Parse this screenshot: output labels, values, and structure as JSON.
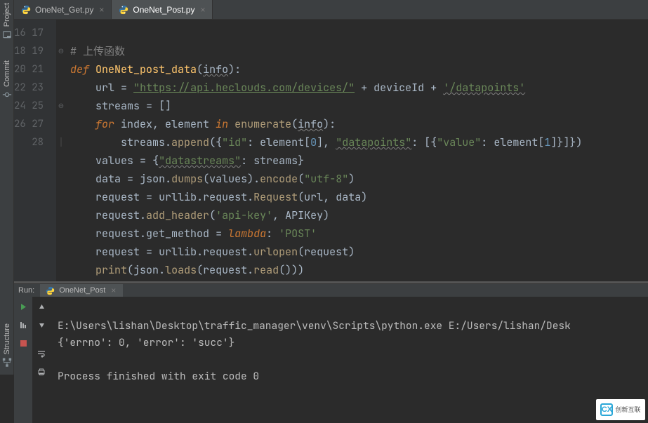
{
  "leftTools": [
    {
      "id": "project",
      "label": "Project"
    },
    {
      "id": "commit",
      "label": "Commit"
    },
    {
      "id": "structure",
      "label": "Structure"
    }
  ],
  "tabs": [
    {
      "id": "get",
      "label": "OneNet_Get.py",
      "active": false
    },
    {
      "id": "post",
      "label": "OneNet_Post.py",
      "active": true
    }
  ],
  "lineStart": 16,
  "lineEnd": 28,
  "code": {
    "l16": "# 上传函数",
    "l17_def": "def",
    "l17_name": "OneNet_post_data",
    "l17_arg": "info",
    "l18_url": "url",
    "l18_s1": "\"https://api.heclouds.com/devices/\"",
    "l18_dev": "deviceId",
    "l18_s2": "'/datapoints'",
    "l19": "streams = []",
    "l20_for": "for",
    "l20_idx": "index, element",
    "l20_in": "in",
    "l20_enum": "enumerate",
    "l20_arg": "info",
    "l21_streams": "streams",
    "l21_append": "append",
    "l21_id": "\"id\"",
    "l21_el": "element",
    "l21_z": "0",
    "l21_dp": "\"datapoints\"",
    "l21_val": "\"value\"",
    "l21_one": "1",
    "l22_values": "values",
    "l22_ds": "\"datastreams\"",
    "l22_streams": "streams",
    "l23_data": "data",
    "l23_json": "json",
    "l23_dumps": "dumps",
    "l23_vals": "values",
    "l23_enc": "encode",
    "l23_utf": "\"utf-8\"",
    "l24_req": "request",
    "l24_urllib": "urllib",
    "l24_r2": "request",
    "l24_Req": "Request",
    "l24_url": "url",
    "l24_data": "data",
    "l25_req": "request",
    "l25_add": "add_header",
    "l25_key": "'api-key'",
    "l25_api": "APIKey",
    "l26_req": "request",
    "l26_gm": "get_method",
    "l26_lambda": "lambda",
    "l26_post": "'POST'",
    "l27_req": "request",
    "l27_urllib": "urllib",
    "l27_r2": "request",
    "l27_open": "urlopen",
    "l27_arg": "request",
    "l28_print": "print",
    "l28_json": "json",
    "l28_loads": "loads",
    "l28_req": "request",
    "l28_read": "read"
  },
  "run": {
    "label": "Run:",
    "tabName": "OneNet_Post",
    "line1": "E:\\Users\\lishan\\Desktop\\traffic_manager\\venv\\Scripts\\python.exe E:/Users/lishan/Desk",
    "line2": "{'errno': 0, 'error': 'succ'}",
    "line3": "Process finished with exit code 0"
  },
  "watermark": "创新互联"
}
